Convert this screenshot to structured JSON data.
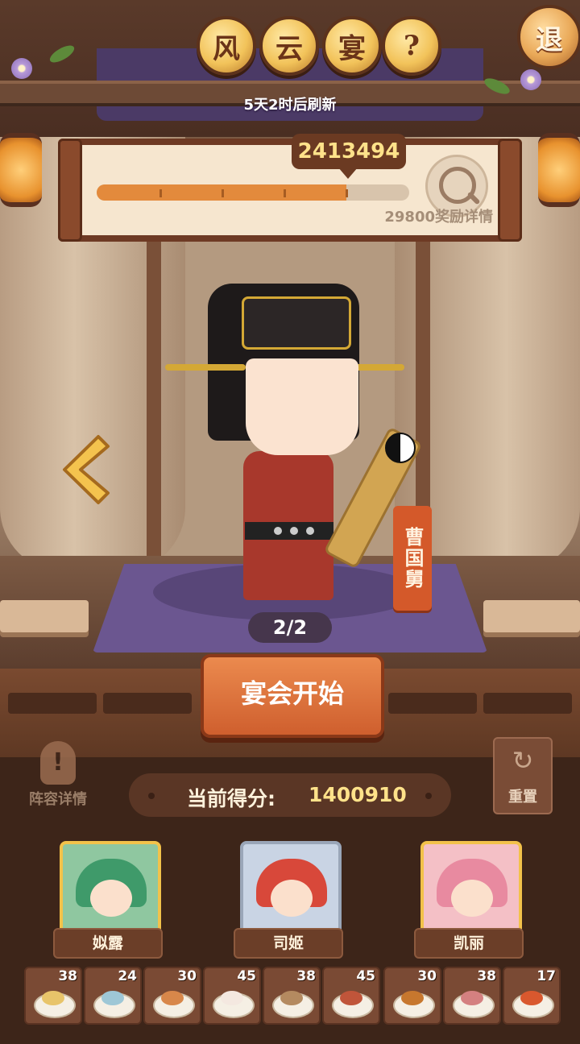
{
  "header": {
    "title_chars": [
      "风",
      "云",
      "宴"
    ],
    "help_label": "?",
    "refresh_text": "5天2时后刷新",
    "exit_label": "退"
  },
  "score_panel": {
    "target_score": "2413494",
    "progress_fraction": 0.8,
    "reward_text": "29800奖励详情"
  },
  "character": {
    "name": "曹国舅",
    "page": "2/2"
  },
  "actions": {
    "start_label": "宴会开始",
    "lineup_label": "阵容详情",
    "lineup_icon": "!",
    "reset_label": "重置",
    "reset_icon": "↻"
  },
  "score": {
    "label": "当前得分:",
    "value": "1400910"
  },
  "heroes": [
    {
      "name": "姒露",
      "icon": "hero-portrait-green"
    },
    {
      "name": "司姬",
      "icon": "hero-portrait-red"
    },
    {
      "name": "凯丽",
      "icon": "hero-portrait-pink"
    }
  ],
  "items": [
    {
      "count": "38",
      "color": "#e8c46a"
    },
    {
      "count": "24",
      "color": "#9ec7d6"
    },
    {
      "count": "30",
      "color": "#d8874a"
    },
    {
      "count": "45",
      "color": "#f4e8e0"
    },
    {
      "count": "38",
      "color": "#b48a60"
    },
    {
      "count": "45",
      "color": "#c0553a"
    },
    {
      "count": "30",
      "color": "#c7772e"
    },
    {
      "count": "38",
      "color": "#d48080"
    },
    {
      "count": "17",
      "color": "#d9582e"
    }
  ],
  "colors": {
    "accent_gold": "#f2c24a",
    "button_orange": "#cf5f2e",
    "progress_orange": "#e38a3c"
  }
}
